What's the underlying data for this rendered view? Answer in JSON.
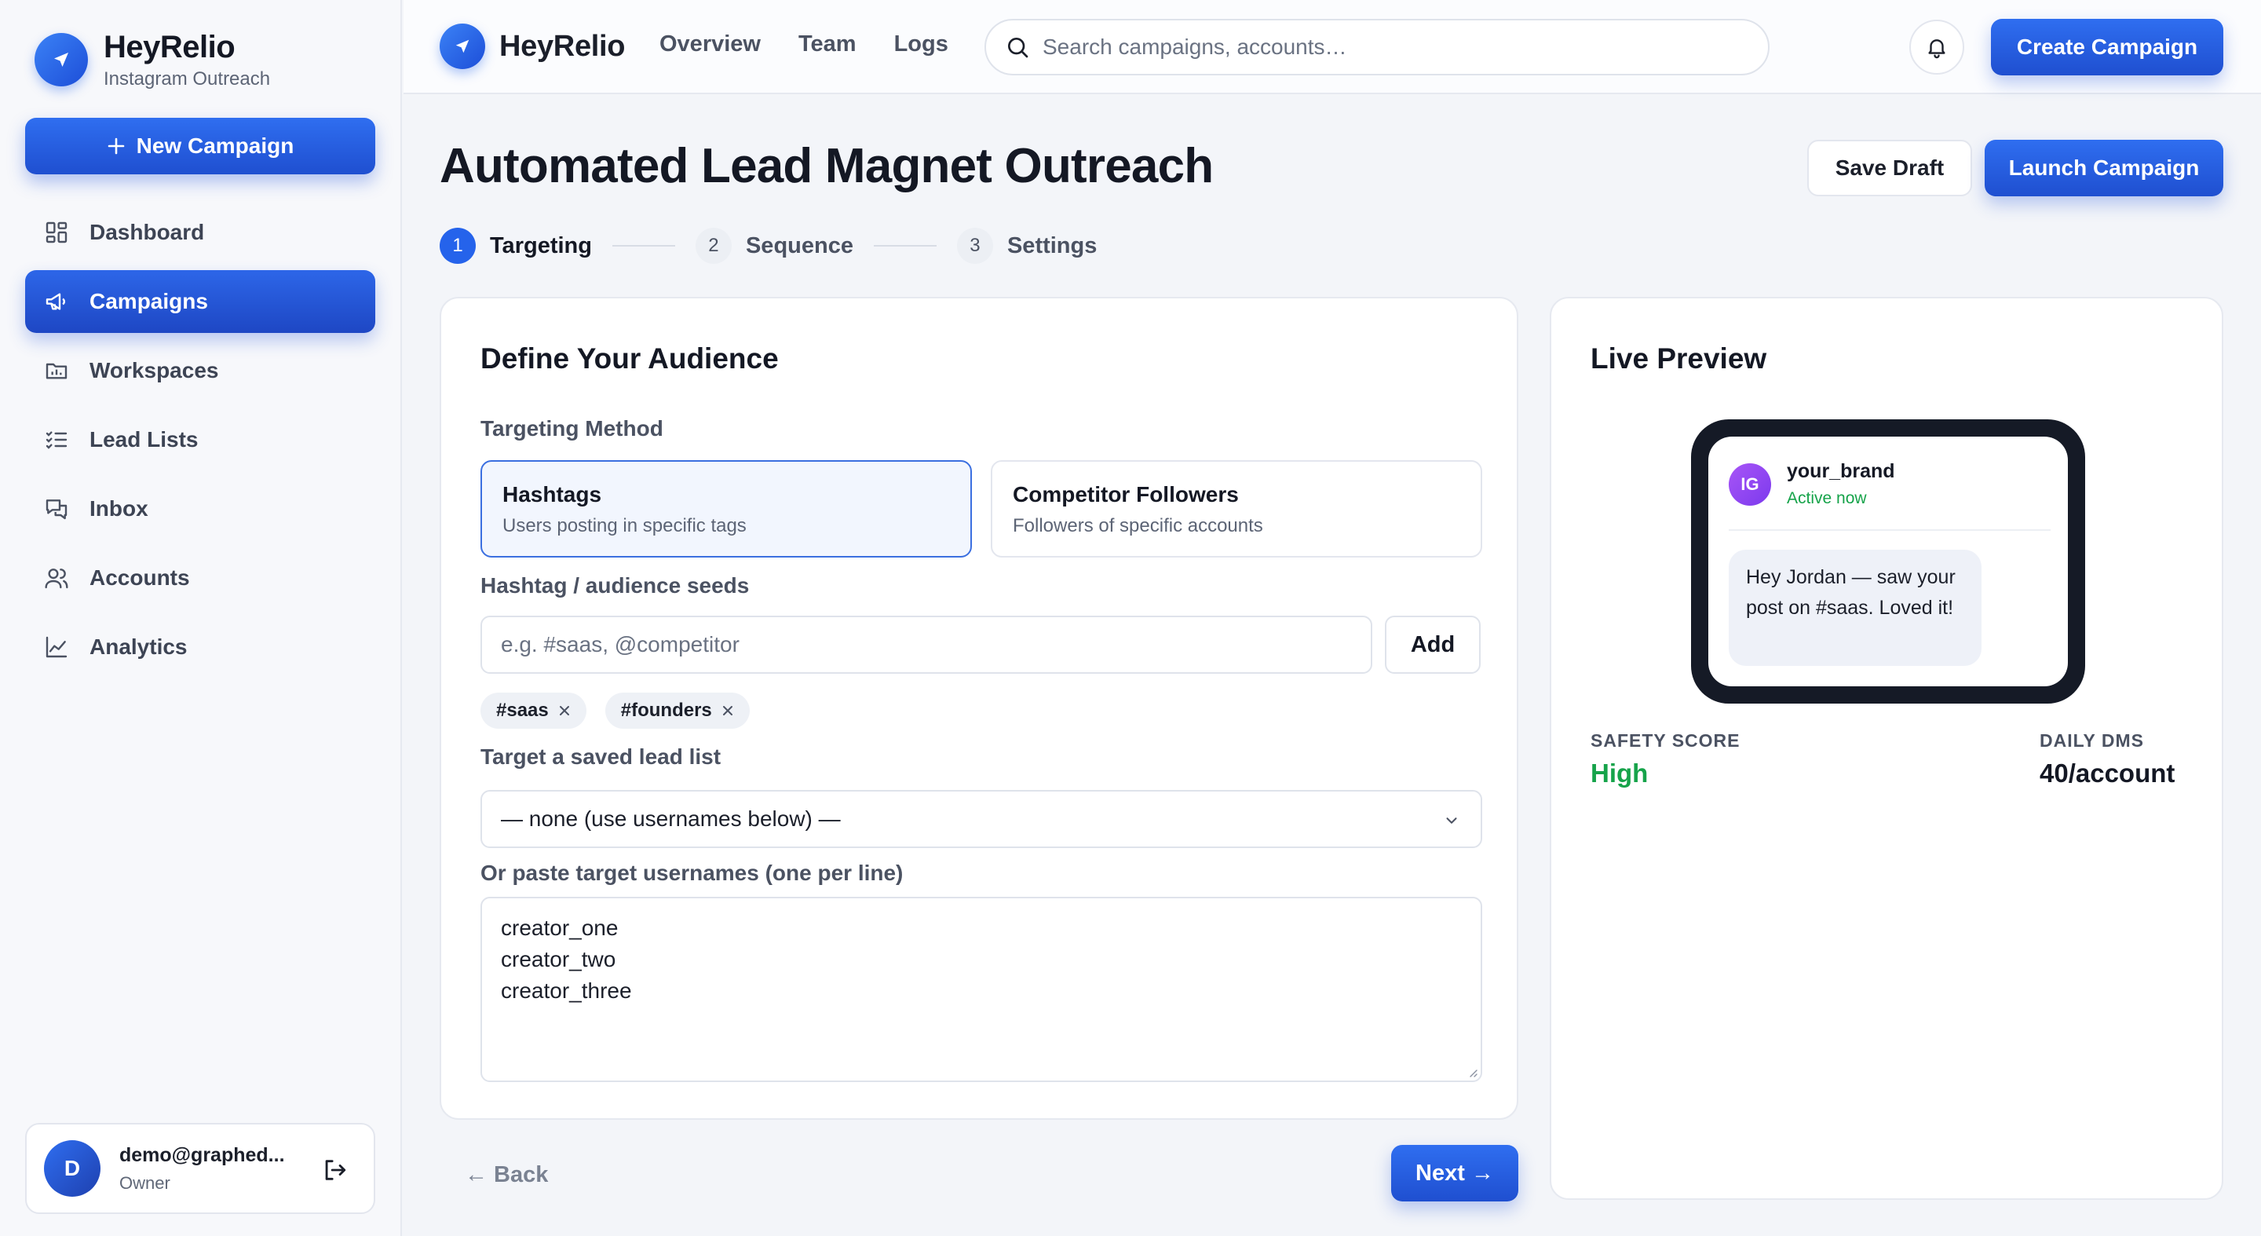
{
  "app": {
    "name": "HeyRelio",
    "subtitle": "Instagram Outreach"
  },
  "sidebar": {
    "new_campaign_label": "New Campaign",
    "items": [
      {
        "label": "Dashboard",
        "icon": "dashboard-icon",
        "active": false
      },
      {
        "label": "Campaigns",
        "icon": "megaphone-icon",
        "active": true
      },
      {
        "label": "Workspaces",
        "icon": "folder-chart-icon",
        "active": false
      },
      {
        "label": "Lead Lists",
        "icon": "checklist-icon",
        "active": false
      },
      {
        "label": "Inbox",
        "icon": "chat-icon",
        "active": false
      },
      {
        "label": "Accounts",
        "icon": "users-icon",
        "active": false
      },
      {
        "label": "Analytics",
        "icon": "line-chart-icon",
        "active": false
      }
    ],
    "user": {
      "initial": "D",
      "email": "demo@graphed...",
      "role": "Owner"
    }
  },
  "topbar": {
    "brand": "HeyRelio",
    "links": [
      "Overview",
      "Team",
      "Logs"
    ],
    "search_placeholder": "Search campaigns, accounts…",
    "create_label": "Create Campaign"
  },
  "page": {
    "title": "Automated Lead Magnet Outreach",
    "save_draft_label": "Save Draft",
    "launch_label": "Launch Campaign",
    "steps": [
      {
        "num": "1",
        "label": "Targeting",
        "active": true
      },
      {
        "num": "2",
        "label": "Sequence",
        "active": false
      },
      {
        "num": "3",
        "label": "Settings",
        "active": false
      }
    ]
  },
  "form": {
    "title": "Define Your Audience",
    "method_label": "Targeting Method",
    "options": [
      {
        "title": "Hashtags",
        "desc": "Users posting in specific tags",
        "selected": true
      },
      {
        "title": "Competitor Followers",
        "desc": "Followers of specific accounts",
        "selected": false
      }
    ],
    "seeds_label": "Hashtag / audience seeds",
    "seeds_placeholder": "e.g. #saas, @competitor",
    "add_label": "Add",
    "tags": [
      "#saas",
      "#founders"
    ],
    "lead_list_label": "Target a saved lead list",
    "lead_list_value": "— none (use usernames below) —",
    "usernames_label": "Or paste target usernames (one per line)",
    "usernames": [
      "creator_one",
      "creator_two",
      "creator_three"
    ],
    "back_label": "← Back",
    "next_label": "Next →"
  },
  "preview": {
    "title": "Live Preview",
    "avatar": "IG",
    "username": "your_brand",
    "status": "Active now",
    "message": "Hey Jordan — saw your post on #saas. Loved it!",
    "safety_label": "SAFETY SCORE",
    "safety_value": "High",
    "daily_label": "DAILY DMS",
    "daily_value": "40/account"
  },
  "colors": {
    "accent": "#2563eb",
    "success": "#16a34a",
    "ig_avatar": "#8b5cf6"
  }
}
